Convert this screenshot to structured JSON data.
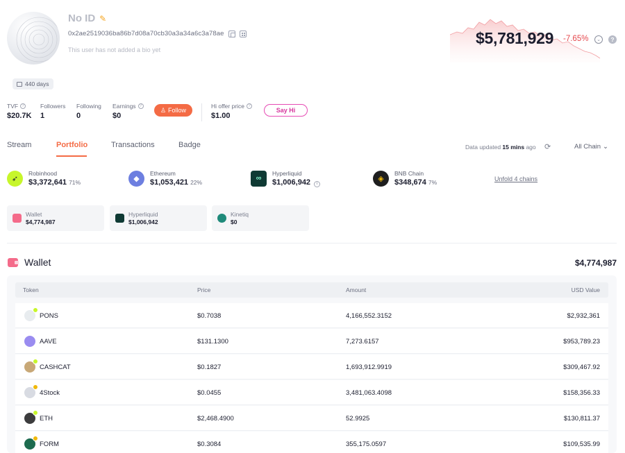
{
  "profile": {
    "name": "No ID",
    "address": "0x2ae2519036ba86b7d08a70cb30a3a34a6c3a78ae",
    "bio": "This user has not added a bio yet",
    "days": "440 days"
  },
  "networth": {
    "value": "$5,781,929",
    "change": "-7.65%",
    "change_color": "#e5484d"
  },
  "stats": {
    "tvf": {
      "label": "TVF",
      "value": "$20.7K"
    },
    "followers": {
      "label": "Followers",
      "value": "1"
    },
    "following": {
      "label": "Following",
      "value": "0"
    },
    "earnings": {
      "label": "Earnings",
      "value": "$0"
    },
    "follow_label": "Follow",
    "hi_offer": {
      "label": "Hi offer price",
      "value": "$1.00"
    },
    "say_hi_label": "Say Hi"
  },
  "tabs": [
    "Stream",
    "Portfolio",
    "Transactions",
    "Badge"
  ],
  "active_tab": "Portfolio",
  "data_updated": {
    "prefix": "Data updated",
    "time": "15 mins",
    "suffix": "ago"
  },
  "chain_filter": "All Chain",
  "chains": [
    {
      "name": "Robinhood",
      "amount": "$3,372,641",
      "pct": "71%",
      "icon": "robinhood-icon",
      "color": "#c7f62b"
    },
    {
      "name": "Ethereum",
      "amount": "$1,053,421",
      "pct": "22%",
      "icon": "ethereum-icon",
      "color": "#6d7fe0"
    },
    {
      "name": "Hyperliquid",
      "amount": "$1,006,942",
      "pct": "",
      "icon": "hyperliquid-icon",
      "color": "#0f3a34"
    },
    {
      "name": "BNB Chain",
      "amount": "$348,674",
      "pct": "7%",
      "icon": "bnb-icon",
      "color": "#1e1e1e"
    }
  ],
  "unfold_label": "Unfold 4 chains",
  "protocols": [
    {
      "name": "Wallet",
      "value": "$4,774,987",
      "icon": "wallet-icon"
    },
    {
      "name": "Hyperliquid",
      "value": "$1,006,942",
      "icon": "hyperliquid-icon"
    },
    {
      "name": "Kinetiq",
      "value": "$0",
      "icon": "kinetiq-icon"
    }
  ],
  "wallet": {
    "title": "Wallet",
    "total": "$4,774,987",
    "columns": [
      "Token",
      "Price",
      "Amount",
      "USD Value"
    ],
    "rows": [
      {
        "token": "PONS",
        "price": "$0.7038",
        "amount": "4,166,552.3152",
        "usd": "$2,932,361",
        "icon": "pons-icon",
        "color": "#e8ecef",
        "chain_color": "#c7f62b"
      },
      {
        "token": "AAVE",
        "price": "$131.1300",
        "amount": "7,273.6157",
        "usd": "$953,789.23",
        "icon": "aave-icon",
        "color": "#9a8cf0",
        "chain_color": ""
      },
      {
        "token": "CASHCAT",
        "price": "$0.1827",
        "amount": "1,693,912.9919",
        "usd": "$309,467.92",
        "icon": "cashcat-icon",
        "color": "#c8a877",
        "chain_color": "#c7f62b"
      },
      {
        "token": "4Stock",
        "price": "$0.0455",
        "amount": "3,481,063.4098",
        "usd": "$158,356.33",
        "icon": "4stock-icon",
        "color": "#d8dbe2",
        "chain_color": "#f0b90b"
      },
      {
        "token": "ETH",
        "price": "$2,468.4900",
        "amount": "52.9925",
        "usd": "$130,811.37",
        "icon": "eth-icon",
        "color": "#3c3c3d",
        "chain_color": "#c7f62b"
      },
      {
        "token": "FORM",
        "price": "$0.3084",
        "amount": "355,175.0597",
        "usd": "$109,535.99",
        "icon": "form-icon",
        "color": "#1d6b4f",
        "chain_color": "#f0b90b"
      }
    ]
  }
}
